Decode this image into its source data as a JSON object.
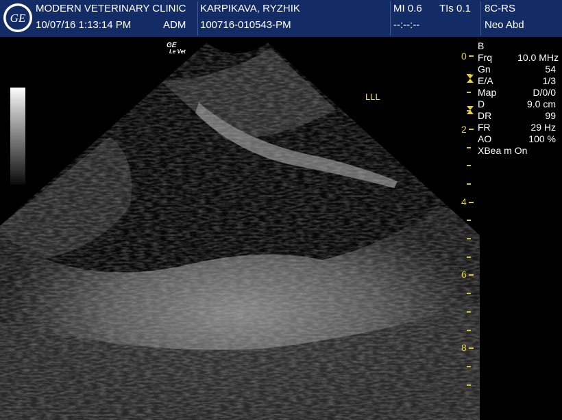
{
  "header": {
    "clinic": "MODERN VETERINARY CLINIC",
    "datetime": "10/07/16 1:13:14 PM",
    "operator": "ADM",
    "patient_name": "KARPIKAVA, RYZHIK",
    "patient_id": "100716-010543-PM",
    "mi": "MI 0.6",
    "tis": "TIs 0.1",
    "mi_sub": "--:--:--",
    "probe": "8C-RS",
    "preset": "Neo Abd"
  },
  "overlay": {
    "ge_logo": "GE",
    "le_vet": "Le Vet",
    "label": "LLL"
  },
  "params": {
    "mode": "B",
    "rows": [
      {
        "label": "Frq",
        "value": "10.0 MHz"
      },
      {
        "label": "Gn",
        "value": "54"
      },
      {
        "label": "E/A",
        "value": "1/3"
      },
      {
        "label": "Map",
        "value": "D/0/0"
      },
      {
        "label": "D",
        "value": "9.0 cm"
      },
      {
        "label": "DR",
        "value": "99"
      },
      {
        "label": "FR",
        "value": "29 Hz"
      },
      {
        "label": "AO",
        "value": "100 %"
      }
    ],
    "xbeam": "XBea m On"
  },
  "depth_scale": {
    "labels": [
      "0",
      "2",
      "4",
      "6",
      "8"
    ]
  },
  "colors": {
    "header_bg": "#142c66",
    "accent_yellow": "#e8d23a",
    "label_yellow": "#f0e030"
  }
}
